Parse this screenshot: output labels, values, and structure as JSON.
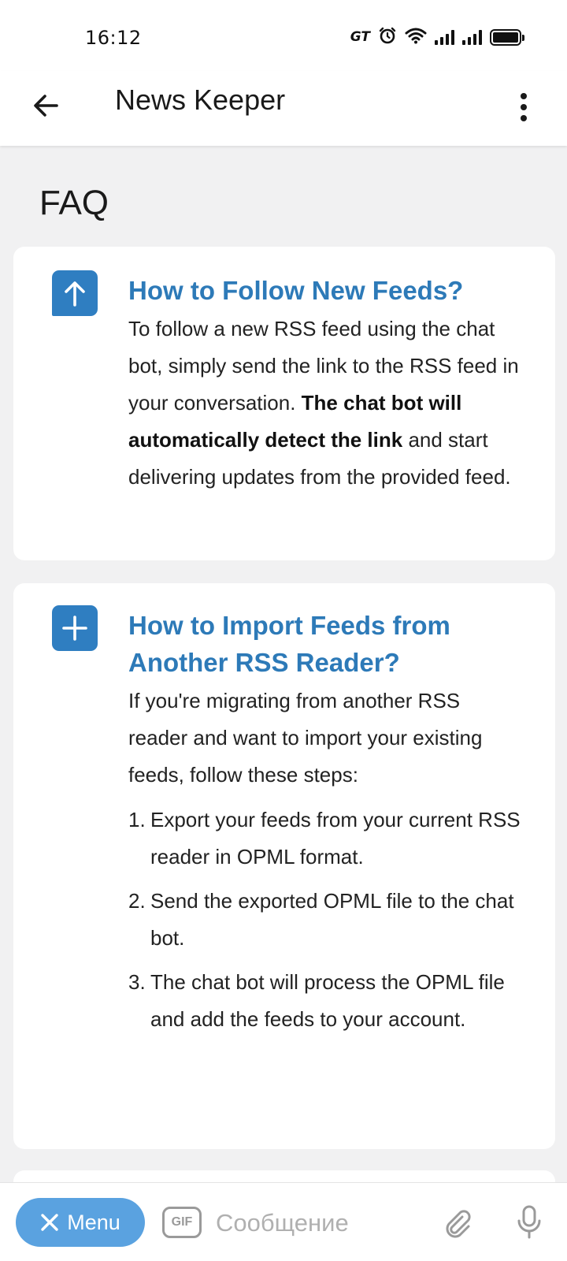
{
  "status_bar": {
    "time": "16:12",
    "carrier_badge": "GT",
    "icons": [
      "alarm-icon",
      "wifi-icon",
      "signal-icon",
      "signal-icon",
      "battery-icon"
    ]
  },
  "app_bar": {
    "title": "News Keeper",
    "back_icon": "arrow-left-icon",
    "menu_icon": "more-vertical-icon"
  },
  "page": {
    "heading": "FAQ"
  },
  "faq": [
    {
      "icon": "arrow-up-icon",
      "title": "How to Follow New Feeds?",
      "text_before": "To follow a new RSS feed using the chat bot, simply send the link to the RSS feed in your conversation. ",
      "text_bold": "The chat bot will automatically detect the link",
      "text_after": " and start delivering updates from the provided feed."
    },
    {
      "icon": "plus-icon",
      "title": "How to Import Feeds from Another RSS Reader?",
      "intro": "If you're migrating from another RSS reader and want to import your existing feeds, follow these steps:",
      "steps": [
        {
          "num": "1.",
          "text": "Export your feeds from your current RSS reader in OPML format."
        },
        {
          "num": "2.",
          "text": "Send the exported OPML file to the chat bot."
        },
        {
          "num": "3.",
          "text": "The chat bot will process the OPML file and add the feeds to your account."
        }
      ]
    }
  ],
  "input_bar": {
    "menu_label": "Menu",
    "gif_label": "GIF",
    "message_placeholder": "Сообщение",
    "colors": {
      "menu_button": "#5aa2e0",
      "accent": "#2d7ab8"
    }
  }
}
